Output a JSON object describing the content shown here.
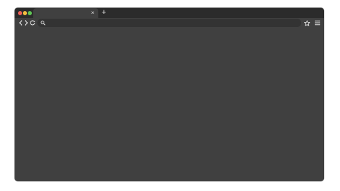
{
  "window": {
    "controls": [
      {
        "name": "close-window",
        "icon": "traffic-light-close",
        "color": "#ee5f57"
      },
      {
        "name": "minimize-window",
        "icon": "traffic-light-minimize",
        "color": "#f2bd3f"
      },
      {
        "name": "maximize-window",
        "icon": "traffic-light-maximize",
        "color": "#5fc555"
      }
    ],
    "background": "#404040",
    "titlebar_color": "#2b2b2b"
  },
  "tabs": [
    {
      "title": "",
      "active": true,
      "close_glyph": "×"
    }
  ],
  "new_tab": {
    "glyph": "+"
  },
  "toolbar": {
    "back_icon": "chevron-left-icon",
    "forward_icon": "chevron-right-icon",
    "reload_icon": "reload-icon",
    "bookmark_icon": "star-icon",
    "menu_icon": "hamburger-menu-icon"
  },
  "address_bar": {
    "icon": "search-icon",
    "value": "",
    "placeholder": ""
  }
}
